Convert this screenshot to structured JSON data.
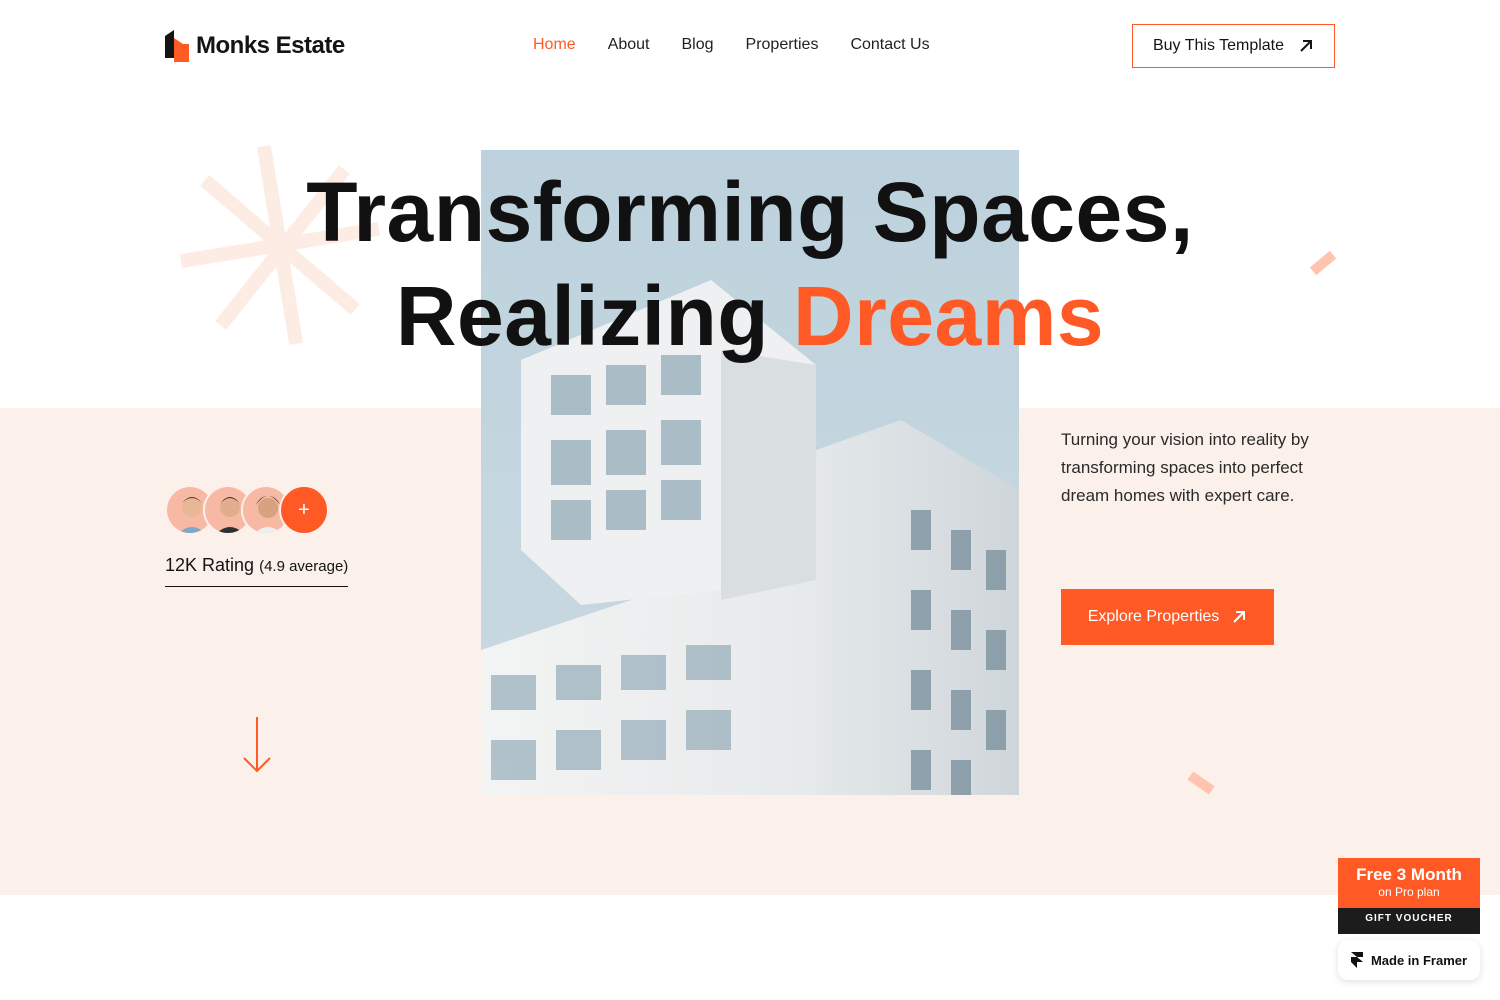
{
  "brand": {
    "name": "Monks Estate",
    "accent": "#ff5a26",
    "band_bg": "#fbf0ea"
  },
  "nav": {
    "items": [
      {
        "label": "Home",
        "active": true
      },
      {
        "label": "About",
        "active": false
      },
      {
        "label": "Blog",
        "active": false
      },
      {
        "label": "Properties",
        "active": false
      },
      {
        "label": "Contact Us",
        "active": false
      }
    ]
  },
  "header": {
    "cta_label": "Buy This Template",
    "cta_icon": "arrow-up-right-icon"
  },
  "hero": {
    "line1": "Transforming Spaces,",
    "line2_plain": "Realizing",
    "line2_accent": "Dreams",
    "description": "Turning your vision into reality by transforming spaces into perfect dream homes with expert care.",
    "cta_label": "Explore Properties",
    "cta_icon": "arrow-up-right-icon"
  },
  "rating": {
    "avatars": [
      "avatar-man-1",
      "avatar-man-2",
      "avatar-man-3"
    ],
    "plus_label": "+",
    "main": "12K Rating",
    "detail": "(4.9 average)"
  },
  "voucher": {
    "title": "Free 3 Month",
    "subtitle": "on Pro plan",
    "footer": "GIFT VOUCHER"
  },
  "framer_badge": {
    "label": "Made in Framer"
  }
}
